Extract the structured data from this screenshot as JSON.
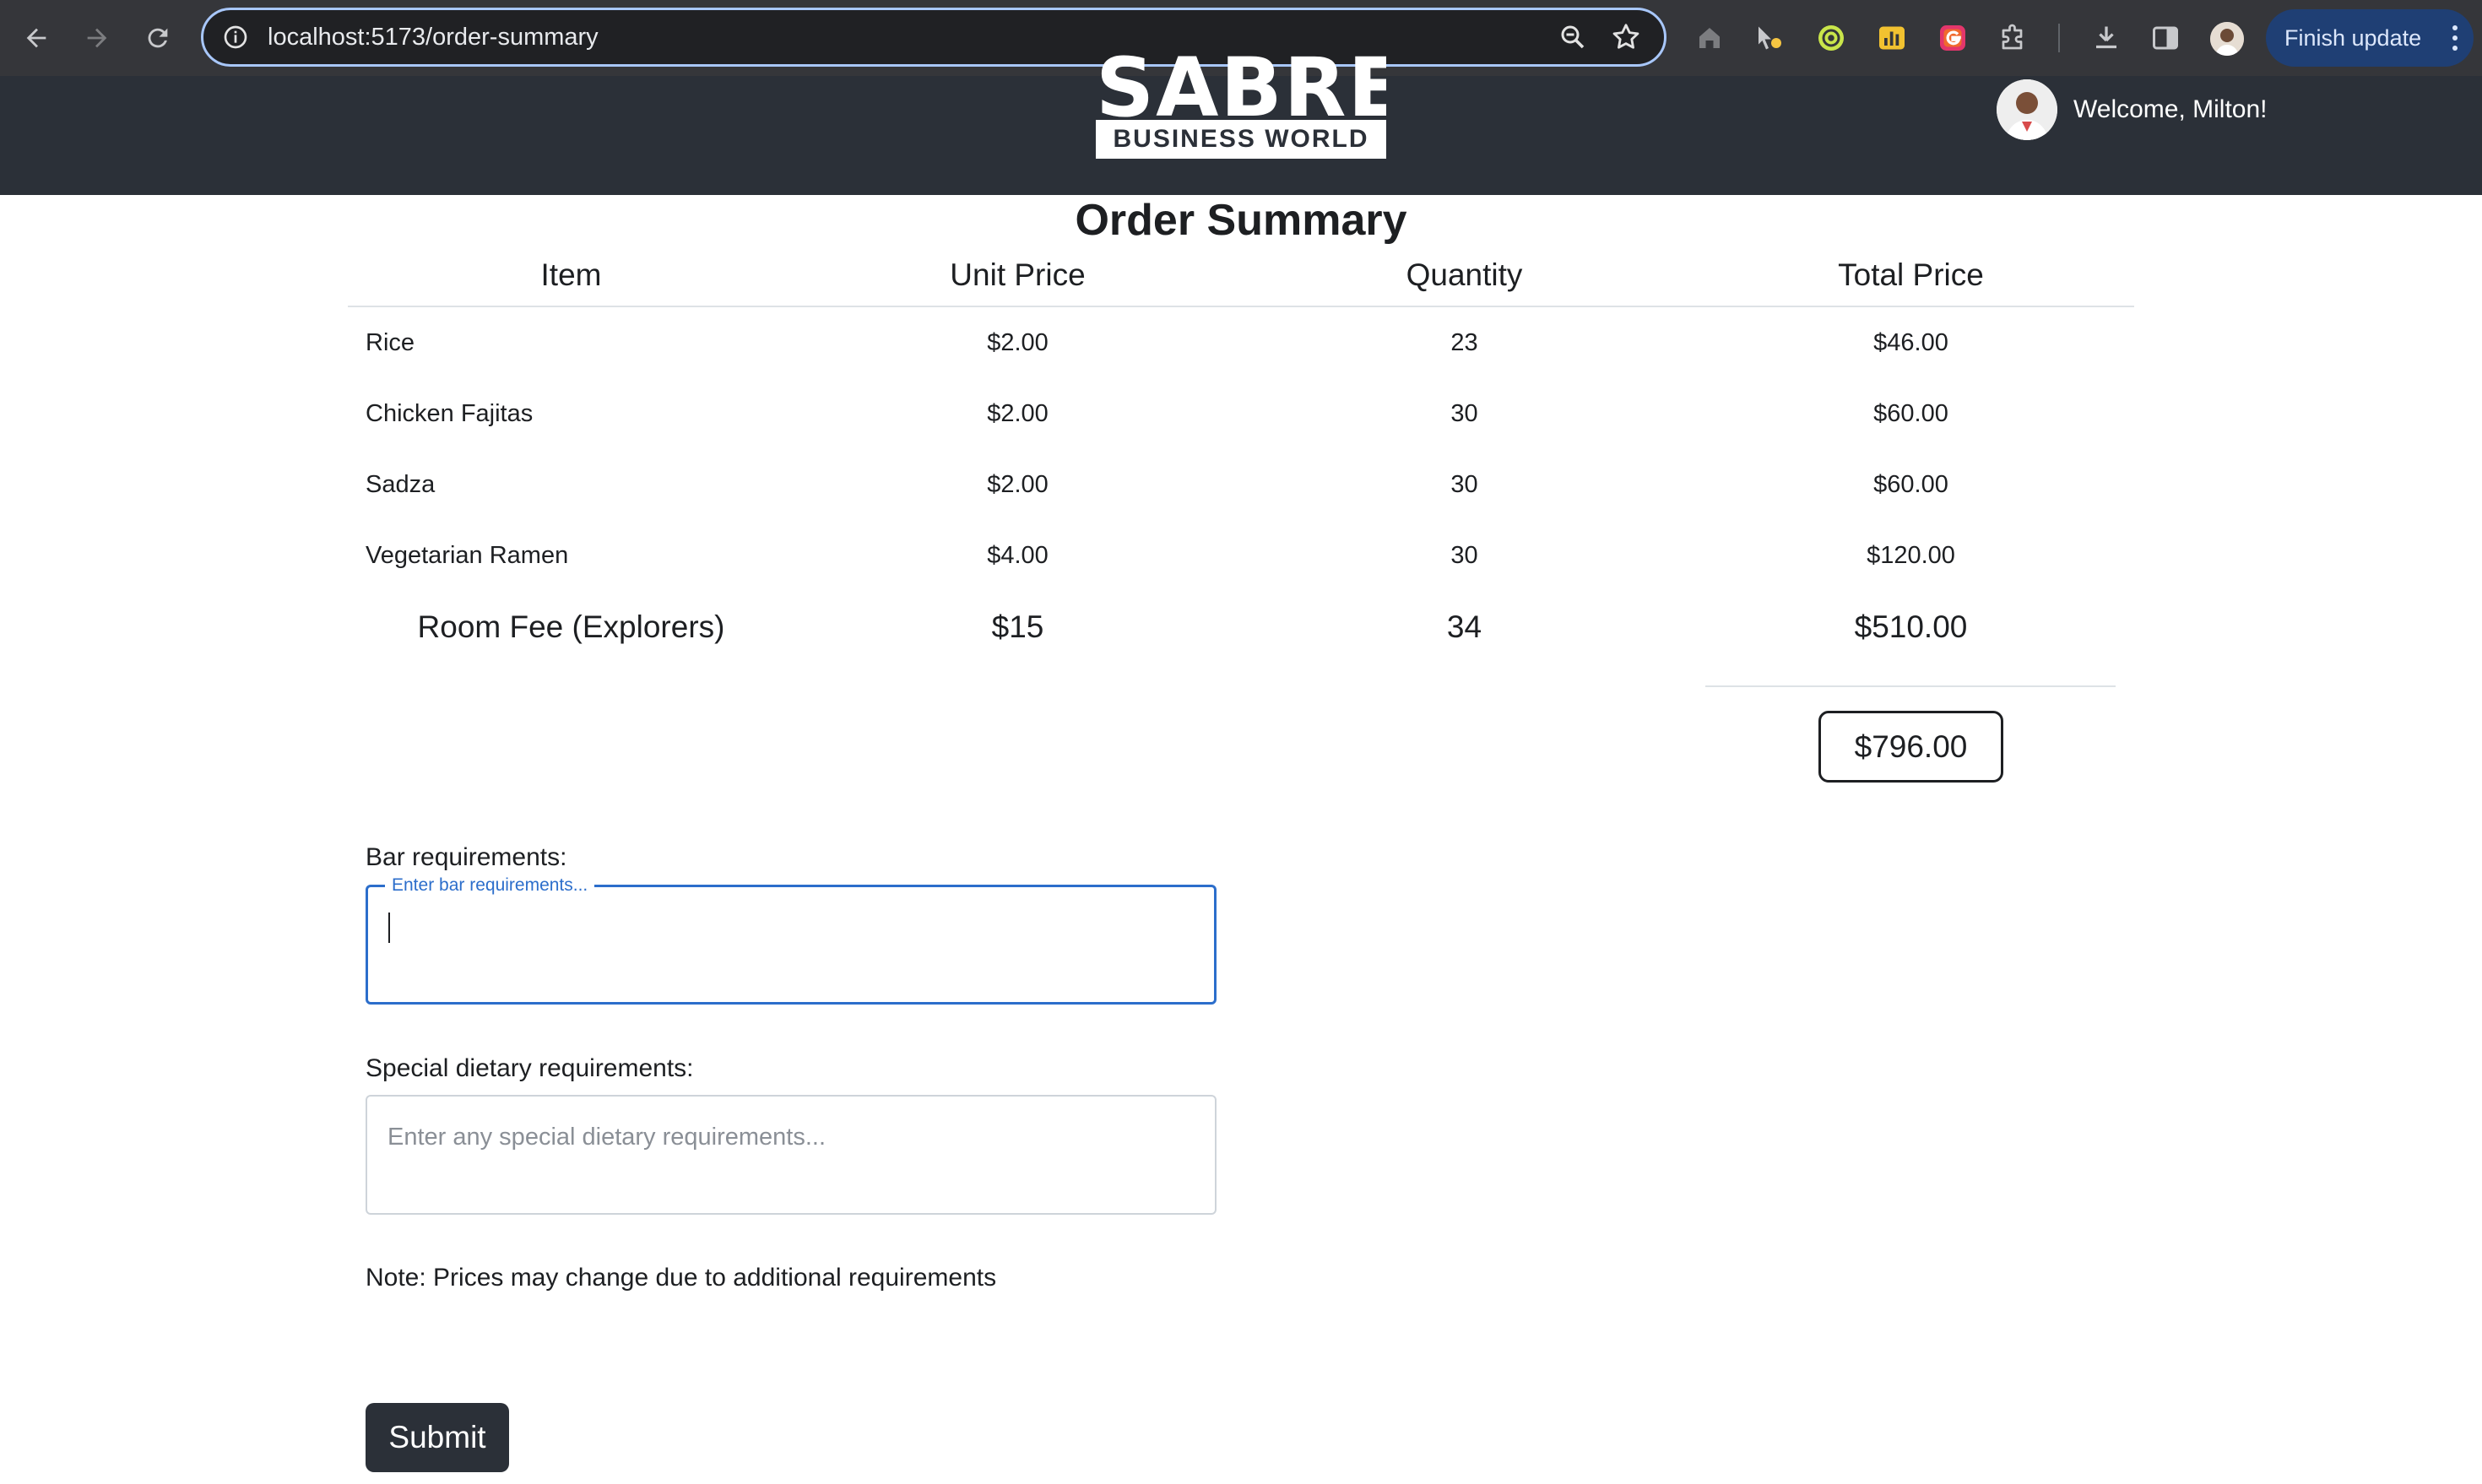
{
  "browser": {
    "url": "localhost:5173/order-summary",
    "finish_update_label": "Finish update"
  },
  "header": {
    "logo_wordmark": "SABRE",
    "logo_subtitle": "BUSINESS WORLD",
    "welcome_text": "Welcome, Milton!"
  },
  "page": {
    "title": "Order Summary"
  },
  "table": {
    "headers": [
      "Item",
      "Unit Price",
      "Quantity",
      "Total Price"
    ],
    "rows": [
      [
        "Rice",
        "$2.00",
        "23",
        "$46.00"
      ],
      [
        "Chicken Fajitas",
        "$2.00",
        "30",
        "$60.00"
      ],
      [
        "Sadza",
        "$2.00",
        "30",
        "$60.00"
      ],
      [
        "Vegetarian Ramen",
        "$4.00",
        "30",
        "$120.00"
      ]
    ],
    "room_fee": [
      "Room Fee (Explorers)",
      "$15",
      "34",
      "$510.00"
    ],
    "grand_total": "$796.00"
  },
  "form": {
    "bar_label": "Bar requirements:",
    "bar_placeholder": "Enter bar requirements...",
    "bar_value": "",
    "dietary_label": "Special dietary requirements:",
    "dietary_placeholder": "Enter any special dietary requirements...",
    "dietary_value": "",
    "note": "Note: Prices may change due to additional requirements",
    "submit_label": "Submit"
  }
}
